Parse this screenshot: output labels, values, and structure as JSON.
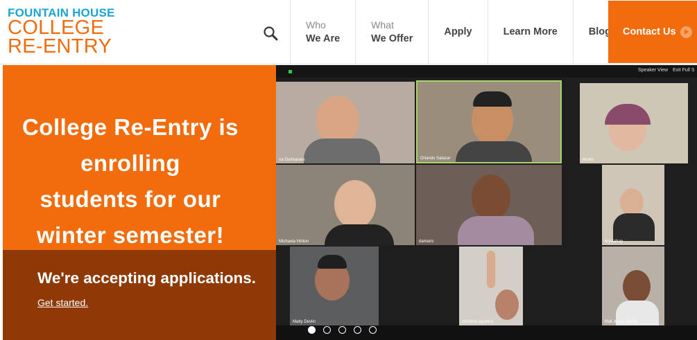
{
  "logo": {
    "line1": "FOUNTAIN HOUSE",
    "line2": "COLLEGE",
    "line3": "RE-ENTRY"
  },
  "nav": [
    {
      "small": "Who",
      "label": "We Are"
    },
    {
      "small": "What",
      "label": "We Offer"
    },
    {
      "small": "",
      "label": "Apply"
    },
    {
      "small": "",
      "label": "Learn More"
    },
    {
      "small": "",
      "label": "Blog"
    }
  ],
  "contact": {
    "label": "Contact Us"
  },
  "hero": {
    "headline": [
      "College Re-Entry is",
      "enrolling",
      "students for our",
      "winter semester!"
    ],
    "subhead": "We're accepting applications.",
    "cta": "Get started."
  },
  "zoom": {
    "topbar": [
      "Speaker View",
      "Exit Full S"
    ],
    "names": [
      "na Guimaraes",
      "Orlando Salazar",
      "kirstin",
      "Michaela Hinton",
      "damaris",
      "krystahap",
      "Matty Devlin",
      "christina aguilera",
      "Rell Jesse Garcia"
    ]
  },
  "carousel": {
    "count": 5,
    "active": 0
  },
  "colors": {
    "brand_orange": "#f26c0d",
    "brand_blue": "#1ba3d6",
    "brown": "#8f3a06"
  }
}
